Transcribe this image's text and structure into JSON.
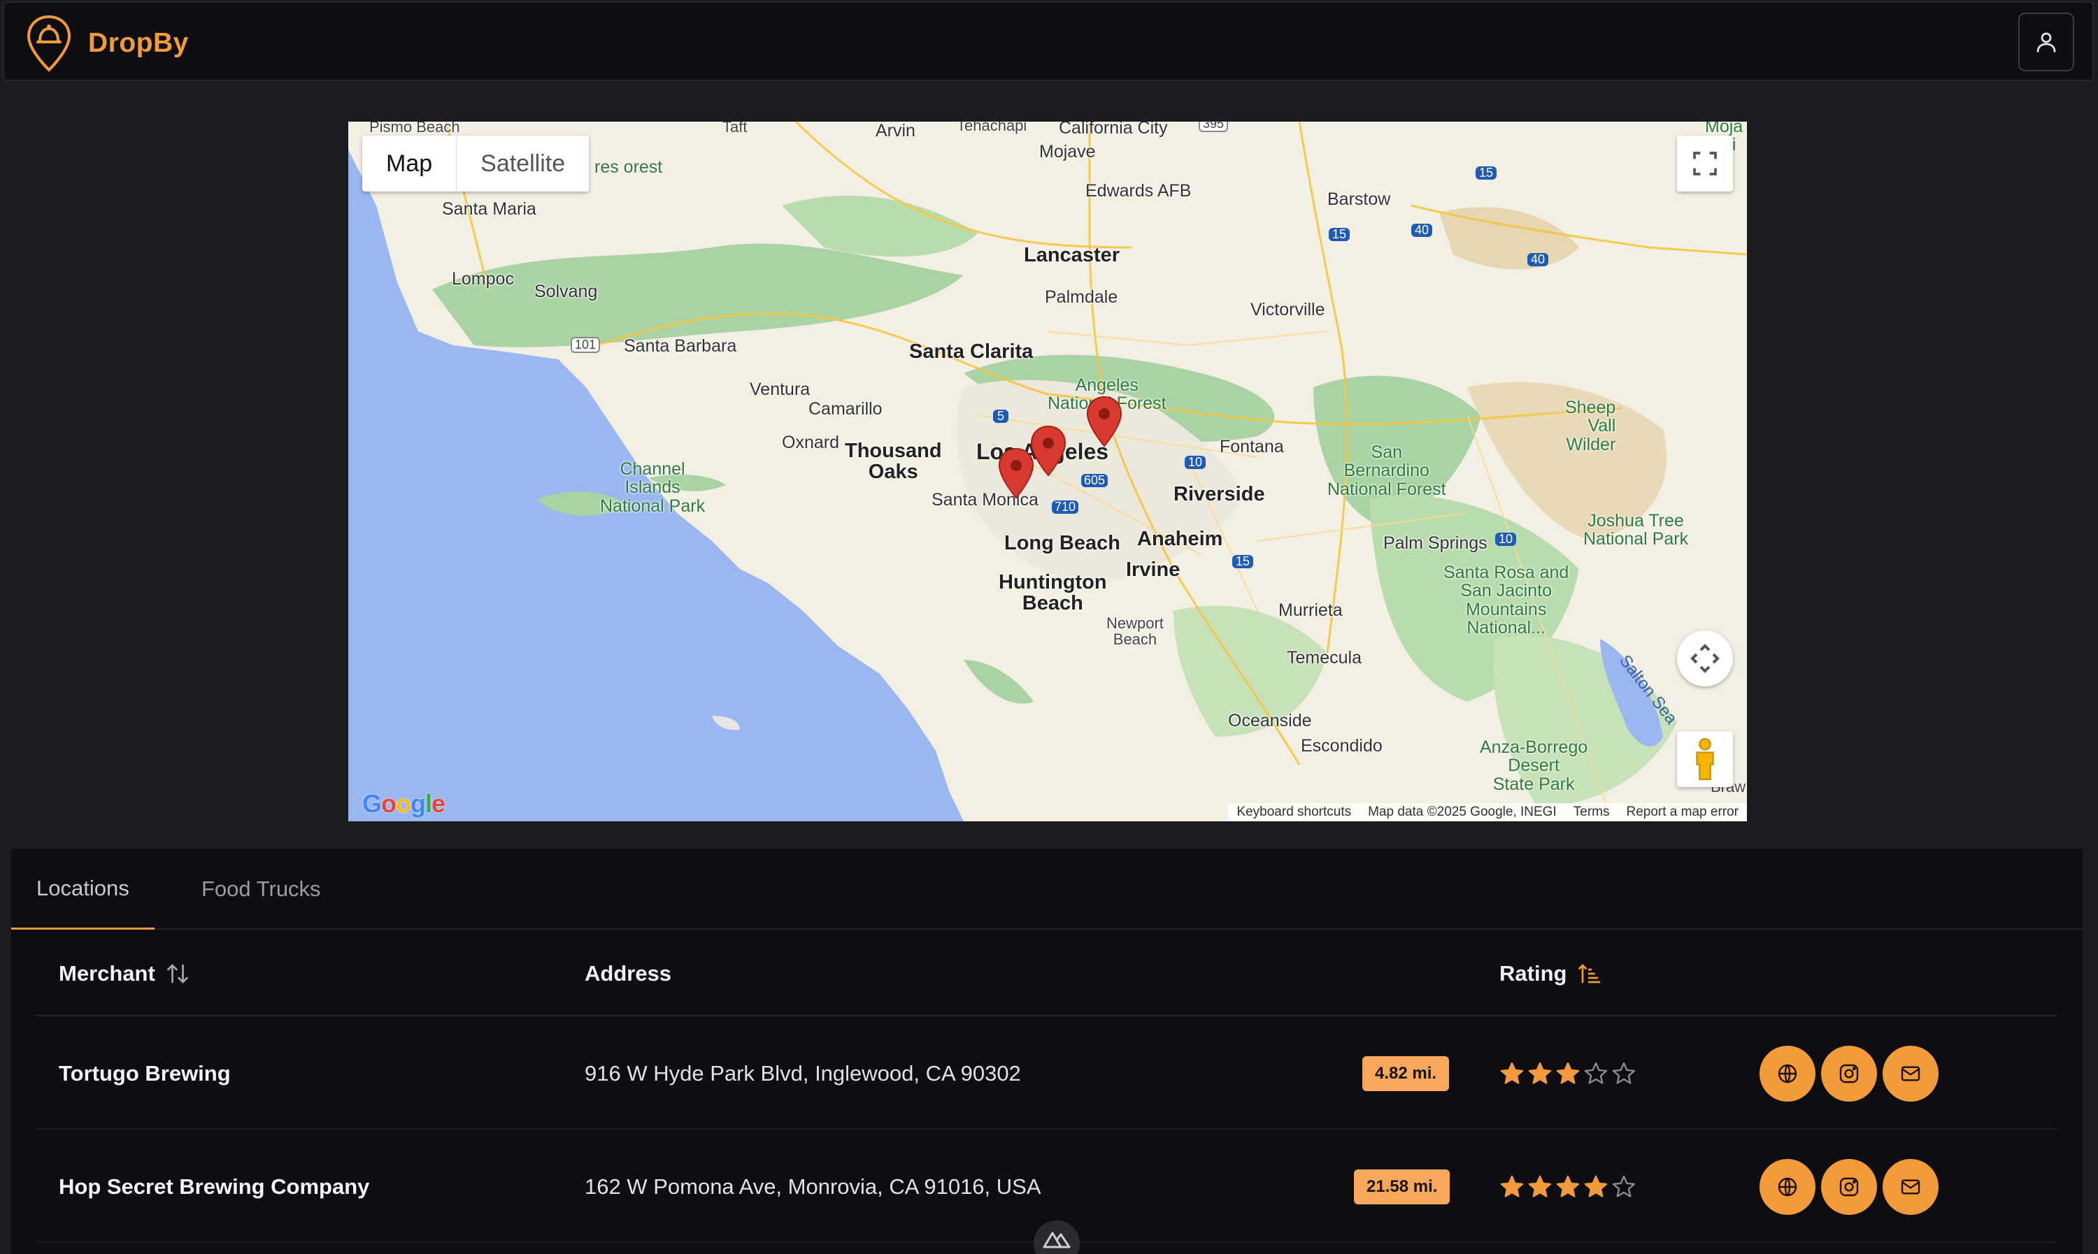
{
  "app": {
    "name": "DropBy"
  },
  "colors": {
    "accent": "#f39a3b",
    "badge": "#f7a85a",
    "background": "#1b1b20",
    "panel": "#0d0d12",
    "pin": "#d93a2f"
  },
  "header": {
    "profile_icon": "user-icon"
  },
  "map": {
    "type_control": {
      "map_label": "Map",
      "satellite_label": "Satellite",
      "selected": "Map"
    },
    "google_logo": "Google",
    "attribution": {
      "keyboard": "Keyboard shortcuts",
      "data": "Map data ©2025 Google, INEGI",
      "terms": "Terms",
      "report": "Report a map error"
    },
    "labels": {
      "pismo_beach": "Pismo Beach",
      "taft": "Taft",
      "arvin": "Arvin",
      "tehachapi": "Tehachapi",
      "california_city": "California City",
      "mojave": "Mojave",
      "edwards_afb": "Edwards AFB",
      "barstow": "Barstow",
      "santa_maria": "Santa Maria",
      "lompoc": "Lompoc",
      "solvang": "Solvang",
      "lancaster": "Lancaster",
      "palmdale": "Palmdale",
      "victorville": "Victorville",
      "santa_barbara": "Santa Barbara",
      "santa_clarita": "Santa Clarita",
      "ventura": "Ventura",
      "camarillo": "Camarillo",
      "oxnard": "Oxnard",
      "thousand_oaks": "Thousand\nOaks",
      "los_angeles": "Los Angeles",
      "santa_monica": "Santa Monica",
      "fontana": "Fontana",
      "riverside": "Riverside",
      "long_beach": "Long Beach",
      "anaheim": "Anaheim",
      "irvine": "Irvine",
      "huntington_beach": "Huntington\nBeach",
      "newport_beach": "Newport\nBeach",
      "murrieta": "Murrieta",
      "temecula": "Temecula",
      "oceanside": "Oceanside",
      "escondido": "Escondido",
      "palm_springs": "Palm Springs",
      "forest_partial": "res\norest",
      "channel_islands": "Channel\nIslands\nNational Park",
      "angeles_nf": "Angeles\nNational Forest",
      "san_bernardino_nf": "San\nBernardino\nNational Forest",
      "joshua_tree": "Joshua Tree\nNational Park",
      "santa_rosa": "Santa Rosa and\nSan Jacinto\nMountains\nNational...",
      "anza_borrego": "Anza-Borrego\nDesert\nState Park",
      "salton_sea": "Salton Sea",
      "sheep_valley": "Sheep\nVall\nWilder",
      "mojave_partial": "Moja\nNati\nse",
      "brawley_partial": "Braw"
    },
    "route_shields": {
      "r595": "395",
      "r15a": "15",
      "r15b": "15",
      "r40a": "40",
      "r40b": "40",
      "r101": "101",
      "r5": "5",
      "r10a": "10",
      "r10b": "10",
      "r605": "605",
      "r710": "710",
      "r15c": "15"
    },
    "pins": 3
  },
  "tabs": [
    {
      "label": "Locations",
      "active": true
    },
    {
      "label": "Food Trucks",
      "active": false
    }
  ],
  "table": {
    "columns": {
      "merchant": "Merchant",
      "address": "Address",
      "rating": "Rating"
    },
    "rows": [
      {
        "merchant": "Tortugo Brewing",
        "address": "916 W Hyde Park Blvd, Inglewood, CA 90302",
        "distance": "4.82 mi.",
        "rating": 3,
        "rating_max": 5
      },
      {
        "merchant": "Hop Secret Brewing Company",
        "address": "162 W Pomona Ave, Monrovia, CA 91016, USA",
        "distance": "21.58 mi.",
        "rating": 4,
        "rating_max": 5
      }
    ],
    "action_icons": [
      "globe-icon",
      "instagram-icon",
      "mail-icon"
    ]
  }
}
